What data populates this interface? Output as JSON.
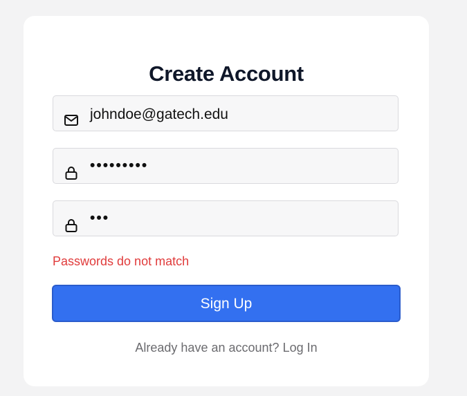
{
  "form": {
    "title": "Create Account",
    "email": {
      "icon": "mail-icon",
      "value": "johndoe@gatech.edu"
    },
    "password": {
      "icon": "lock-icon",
      "masked_value": "•••••••••"
    },
    "confirm_password": {
      "icon": "lock-icon",
      "masked_value": "•••"
    },
    "error_message": "Passwords do not match",
    "submit_label": "Sign Up",
    "footer": {
      "prompt": "Already have an account?",
      "link_label": "Log In"
    }
  },
  "colors": {
    "background": "#f3f3f4",
    "primary_button": "#3370f0",
    "error_text": "#e03b3b",
    "title_text": "#0f1729",
    "muted_text": "#6b6b6f"
  }
}
